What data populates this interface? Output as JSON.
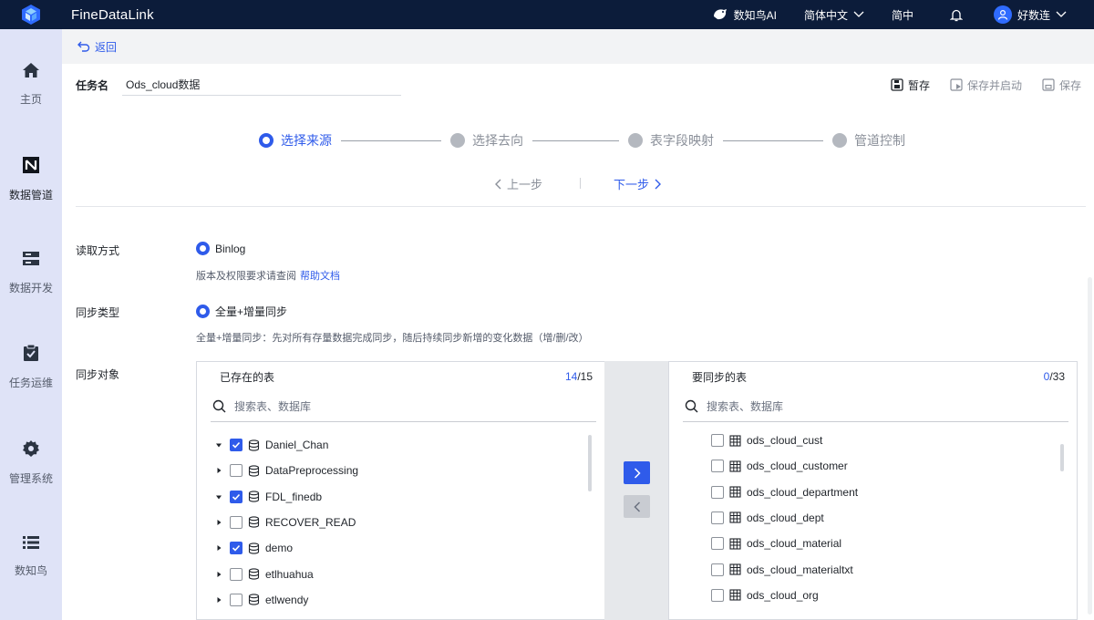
{
  "app": {
    "name": "FineDataLink"
  },
  "topbar": {
    "ai_label": "数知鸟AI",
    "language": "简体中文",
    "lang_short": "简中",
    "user": "好数连"
  },
  "sidebar": {
    "items": [
      {
        "label": "主页",
        "icon": "home-icon"
      },
      {
        "label": "数据管道",
        "icon": "pipeline-icon"
      },
      {
        "label": "数据开发",
        "icon": "server-icon"
      },
      {
        "label": "任务运维",
        "icon": "clipboard-check-icon"
      },
      {
        "label": "管理系统",
        "icon": "gear-icon"
      },
      {
        "label": "数知鸟",
        "icon": "list-icon"
      }
    ],
    "active_index": 1
  },
  "back": {
    "label": "返回"
  },
  "task": {
    "label": "任务名",
    "value": "Ods_cloud数据"
  },
  "actions": {
    "save_draft": "暂存",
    "save_start": "保存并启动",
    "save": "保存"
  },
  "steps": [
    {
      "label": "选择来源",
      "active": true
    },
    {
      "label": "选择去向",
      "active": false
    },
    {
      "label": "表字段映射",
      "active": false
    },
    {
      "label": "管道控制",
      "active": false
    }
  ],
  "nav": {
    "prev": "上一步",
    "next": "下一步"
  },
  "form": {
    "read_mode": {
      "label": "读取方式",
      "option": "Binlog",
      "hint": "版本及权限要求请查阅",
      "link": "帮助文档"
    },
    "sync_type": {
      "label": "同步类型",
      "option": "全量+增量同步",
      "hint": "全量+增量同步：先对所有存量数据完成同步，随后持续同步新增的变化数据（增/删/改）"
    },
    "sync_target": {
      "label": "同步对象"
    }
  },
  "left_panel": {
    "title": "已存在的表",
    "count_selected": "14",
    "count_total": "/15",
    "search_placeholder": "搜索表、数据库",
    "items": [
      {
        "name": "Daniel_Chan",
        "checked": true,
        "expanded": true
      },
      {
        "name": "DataPreprocessing",
        "checked": false,
        "expanded": false
      },
      {
        "name": "FDL_finedb",
        "checked": true,
        "expanded": true
      },
      {
        "name": "RECOVER_READ",
        "checked": false,
        "expanded": false
      },
      {
        "name": "demo",
        "checked": true,
        "expanded": false
      },
      {
        "name": "etlhuahua",
        "checked": false,
        "expanded": false
      },
      {
        "name": "etlwendy",
        "checked": false,
        "expanded": false
      }
    ]
  },
  "right_panel": {
    "title": "要同步的表",
    "count_selected": "0",
    "count_total": "/33",
    "search_placeholder": "搜索表、数据库",
    "items": [
      {
        "name": "ods_cloud_cust"
      },
      {
        "name": "ods_cloud_customer"
      },
      {
        "name": "ods_cloud_department"
      },
      {
        "name": "ods_cloud_dept"
      },
      {
        "name": "ods_cloud_material"
      },
      {
        "name": "ods_cloud_materialtxt"
      },
      {
        "name": "ods_cloud_org"
      }
    ]
  },
  "colors": {
    "accent": "#2f5bea",
    "topbar": "#0c1c3a",
    "sidebar": "#dfe3f7"
  }
}
